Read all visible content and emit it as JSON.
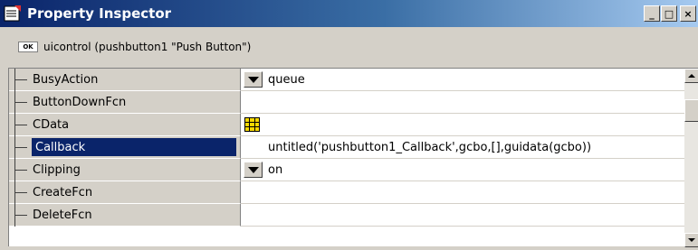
{
  "window": {
    "title": "Property Inspector",
    "minimize_label": "_",
    "maximize_label": "□",
    "close_label": "×"
  },
  "object": {
    "badge": "OK",
    "label": "uicontrol (pushbutton1 \"Push Button\")"
  },
  "properties": [
    {
      "name": "BusyAction",
      "value": "queue",
      "editor": "dropdown"
    },
    {
      "name": "ButtonDownFcn",
      "value": "",
      "editor": "text"
    },
    {
      "name": "CData",
      "value": "",
      "editor": "data-icon"
    },
    {
      "name": "Callback",
      "value": "untitled('pushbutton1_Callback',gcbo,[],guidata(gcbo))",
      "editor": "text",
      "selected": true
    },
    {
      "name": "Clipping",
      "value": "on",
      "editor": "dropdown"
    },
    {
      "name": "CreateFcn",
      "value": "",
      "editor": "text"
    },
    {
      "name": "DeleteFcn",
      "value": "",
      "editor": "text"
    }
  ],
  "colors": {
    "title_bar": "#0a246a",
    "selection": "#0a246a",
    "face": "#d4d0c8"
  }
}
